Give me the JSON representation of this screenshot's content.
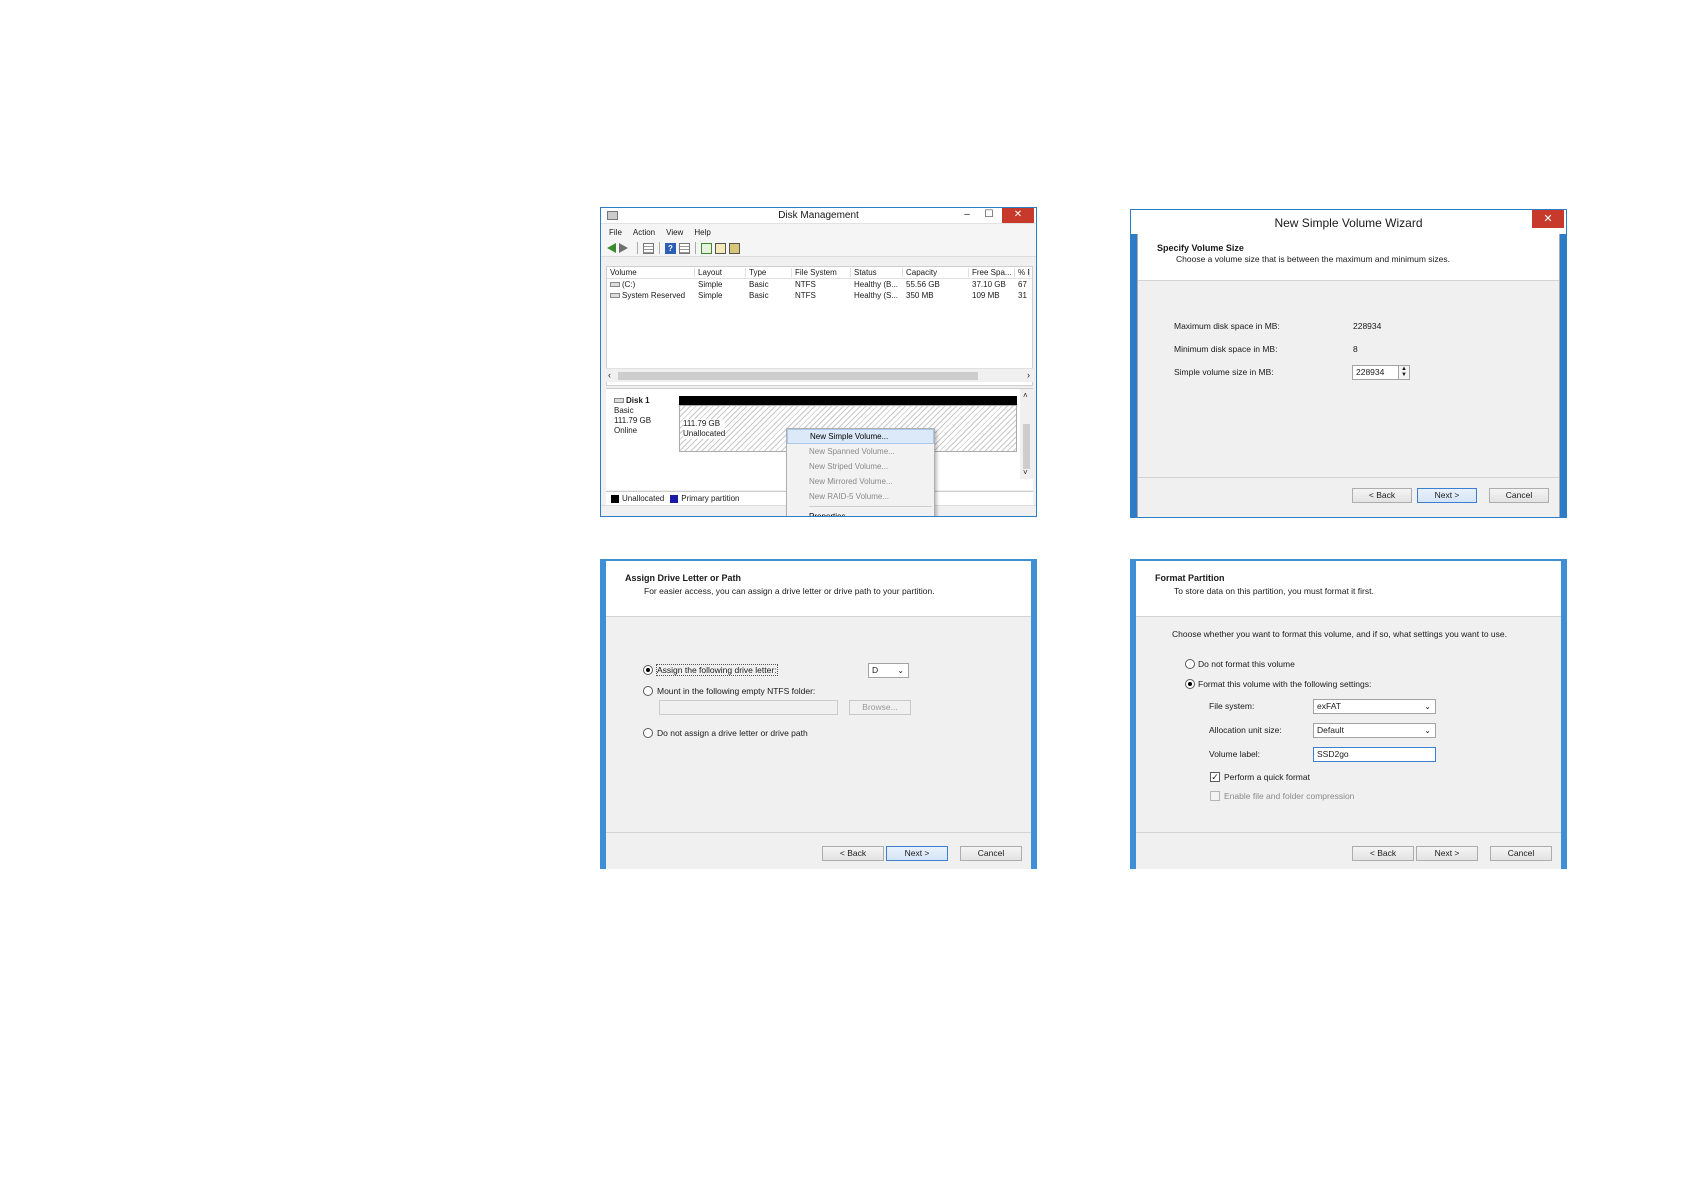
{
  "disk_management": {
    "title": "Disk Management",
    "menu": [
      "File",
      "Action",
      "View",
      "Help"
    ],
    "columns": [
      "Volume",
      "Layout",
      "Type",
      "File System",
      "Status",
      "Capacity",
      "Free Spa...",
      "% F"
    ],
    "rows": [
      [
        "(C:)",
        "Simple",
        "Basic",
        "NTFS",
        "Healthy (B...",
        "55.56 GB",
        "37.10 GB",
        "67"
      ],
      [
        "System Reserved",
        "Simple",
        "Basic",
        "NTFS",
        "Healthy (S...",
        "350 MB",
        "109 MB",
        "31"
      ]
    ],
    "disk": {
      "name": "Disk 1",
      "type": "Basic",
      "size": "111.79 GB",
      "status": "Online",
      "partition_size": "111.79 GB",
      "partition_state": "Unallocated"
    },
    "legend": [
      "Unallocated",
      "Primary partition"
    ],
    "context_menu": {
      "items": [
        "New Simple Volume...",
        "New Spanned Volume...",
        "New Striped Volume...",
        "New Mirrored Volume...",
        "New RAID-5 Volume..."
      ],
      "after_separator": "Properties"
    }
  },
  "size_wizard": {
    "title": "New Simple Volume Wizard",
    "heading": "Specify Volume Size",
    "subheading": "Choose a volume size that is between the maximum and minimum sizes.",
    "max_label": "Maximum disk space in MB:",
    "max_value": "228934",
    "min_label": "Minimum disk space in MB:",
    "min_value": "8",
    "size_label": "Simple volume size in MB:",
    "size_value": "228934",
    "back": "< Back",
    "next": "Next >",
    "cancel": "Cancel"
  },
  "letter_wizard": {
    "heading": "Assign Drive Letter or Path",
    "subheading": "For easier access, you can assign a drive letter or drive path to your partition.",
    "opt_assign": "Assign the following drive letter:",
    "drive_letter": "D",
    "opt_mount": "Mount in the following empty NTFS folder:",
    "browse": "Browse...",
    "opt_none": "Do not assign a drive letter or drive path",
    "back": "< Back",
    "next": "Next >",
    "cancel": "Cancel"
  },
  "format_wizard": {
    "heading": "Format Partition",
    "subheading": "To store data on this partition, you must format it first.",
    "instructions": "Choose whether you want to format this volume, and if so, what settings you want to use.",
    "opt_noformat": "Do not format this volume",
    "opt_format": "Format this volume with the following settings:",
    "fs_label": "File system:",
    "fs_value": "exFAT",
    "alloc_label": "Allocation unit size:",
    "alloc_value": "Default",
    "vol_label": "Volume label:",
    "vol_value": "SSD2go",
    "quick_format": "Perform a quick format",
    "compression": "Enable file and folder compression",
    "back": "< Back",
    "next": "Next >",
    "cancel": "Cancel"
  }
}
